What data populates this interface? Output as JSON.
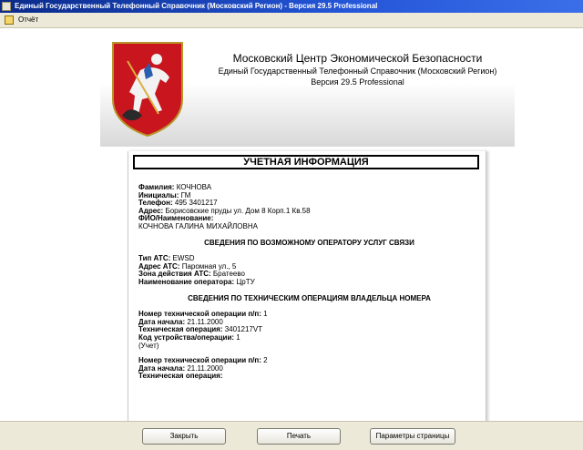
{
  "window": {
    "title": "Единый Государственный Телефонный Справочник (Московский Регион) - Версия 29.5 Professional"
  },
  "menu": {
    "items": [
      "Отчёт"
    ]
  },
  "header": {
    "org_name": "Московский Центр Экономической Безопасности",
    "subtitle": "Единый Государственный Телефонный Справочник (Московский Регион)",
    "version": "Версия 29.5 Professional"
  },
  "report": {
    "title": "УЧЕТНАЯ ИНФОРМАЦИЯ",
    "person": {
      "surname_label": "Фамилия:",
      "surname": "КОЧНОВА",
      "initials_label": "Инициалы:",
      "initials": "ГМ",
      "phone_label": "Телефон:",
      "phone": "495 3401217",
      "address_label": "Адрес:",
      "address": "Борисовские пруды ул. Дом 8 Корп.1 Кв.58",
      "fio_label": "ФИО/Наименование:",
      "fio": "КОЧНОВА ГАЛИНА МИХАЙЛОВНА"
    },
    "operator_section": {
      "heading": "СВЕДЕНИЯ ПО ВОЗМОЖНОМУ ОПЕРАТОРУ УСЛУГ СВЯЗИ",
      "ats_type_label": "Тип АТС:",
      "ats_type": "EWSD",
      "ats_address_label": "Адрес АТС:",
      "ats_address": "Паромная ул., 5",
      "ats_zone_label": "Зона действия АТС:",
      "ats_zone": "Братеево",
      "operator_label": "Наименование оператора:",
      "operator": "ЦрТУ"
    },
    "tech_section": {
      "heading": "СВЕДЕНИЯ ПО ТЕХНИЧЕСКИМ ОПЕРАЦИЯМ ВЛАДЕЛЬЦА НОМЕРА",
      "op_no_label": "Номер технической операции п/п:",
      "start_label": "Дата начала:",
      "op_label": "Техническая операция:",
      "code_label": "Код устройства/операции:",
      "operations": [
        {
          "no": "1",
          "start": "21.11.2000",
          "op": "3401217VT",
          "code": "1",
          "note": "(Учет)"
        },
        {
          "no": "2",
          "start": "21.11.2000"
        }
      ]
    }
  },
  "buttons": {
    "close": "Закрыть",
    "print": "Печать",
    "page_setup": "Параметры страницы"
  }
}
